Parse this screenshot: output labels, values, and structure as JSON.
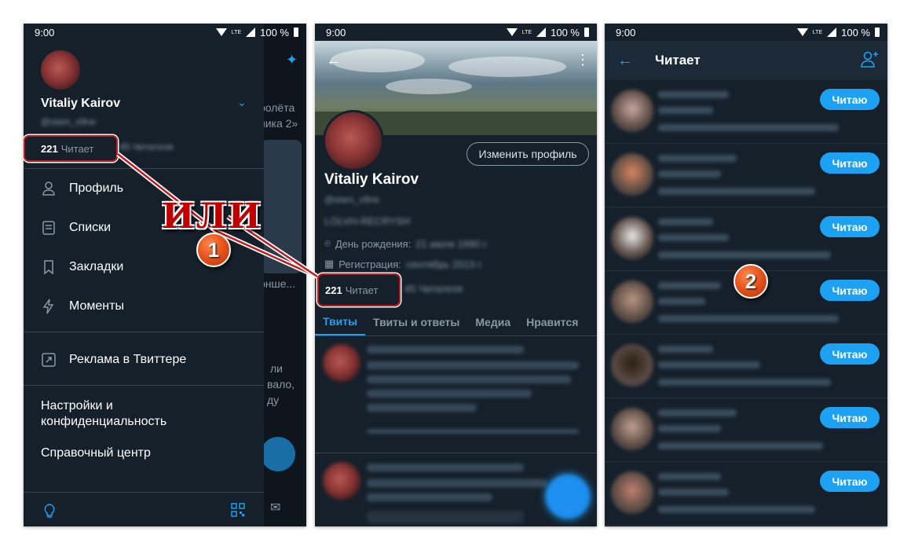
{
  "status": {
    "time": "9:00",
    "network": "LTE",
    "battery": "100 %"
  },
  "drawer": {
    "name": "Vitaliy Kairov",
    "handle": "@slam_v9ne",
    "following_count": "221",
    "following_label": "Читает",
    "followers_label": "45 Читателя",
    "menu": [
      {
        "label": "Профиль",
        "icon": "person-icon"
      },
      {
        "label": "Списки",
        "icon": "list-icon"
      },
      {
        "label": "Закладки",
        "icon": "bookmark-icon"
      },
      {
        "label": "Моменты",
        "icon": "lightning-icon"
      }
    ],
    "ads_label": "Реклама в Твиттере",
    "settings_label": "Настройки и\nконфиденциальность",
    "help_label": "Справочный центр",
    "underlay": [
      "ролёта",
      "ника 2»",
      "рнше...",
      "ли",
      "вало,",
      "ду"
    ]
  },
  "profile": {
    "edit_button": "Изменить профиль",
    "name": "Vitaliy Kairov",
    "handle": "@slam_v9ne",
    "bio": "LOLVH-RECRYSH",
    "birthday_label": "День рождения:",
    "birthday_value": "21 июля 1990 г.",
    "joined_label": "Регистрация:",
    "joined_value": "сентябрь 2013 г.",
    "following_count": "221",
    "following_label": "Читает",
    "followers_label": "45 Читателя",
    "tabs": [
      "Твиты",
      "Твиты и ответы",
      "Медиа",
      "Нравится"
    ]
  },
  "following_screen": {
    "title": "Читает",
    "button_label": "Читаю",
    "rows": 7
  },
  "annotation": {
    "word": "ИЛИ",
    "step1": "1",
    "step2": "2"
  },
  "colors": {
    "accent": "#1da1f2",
    "background": "#15202b",
    "highlight": "#c2191d"
  }
}
